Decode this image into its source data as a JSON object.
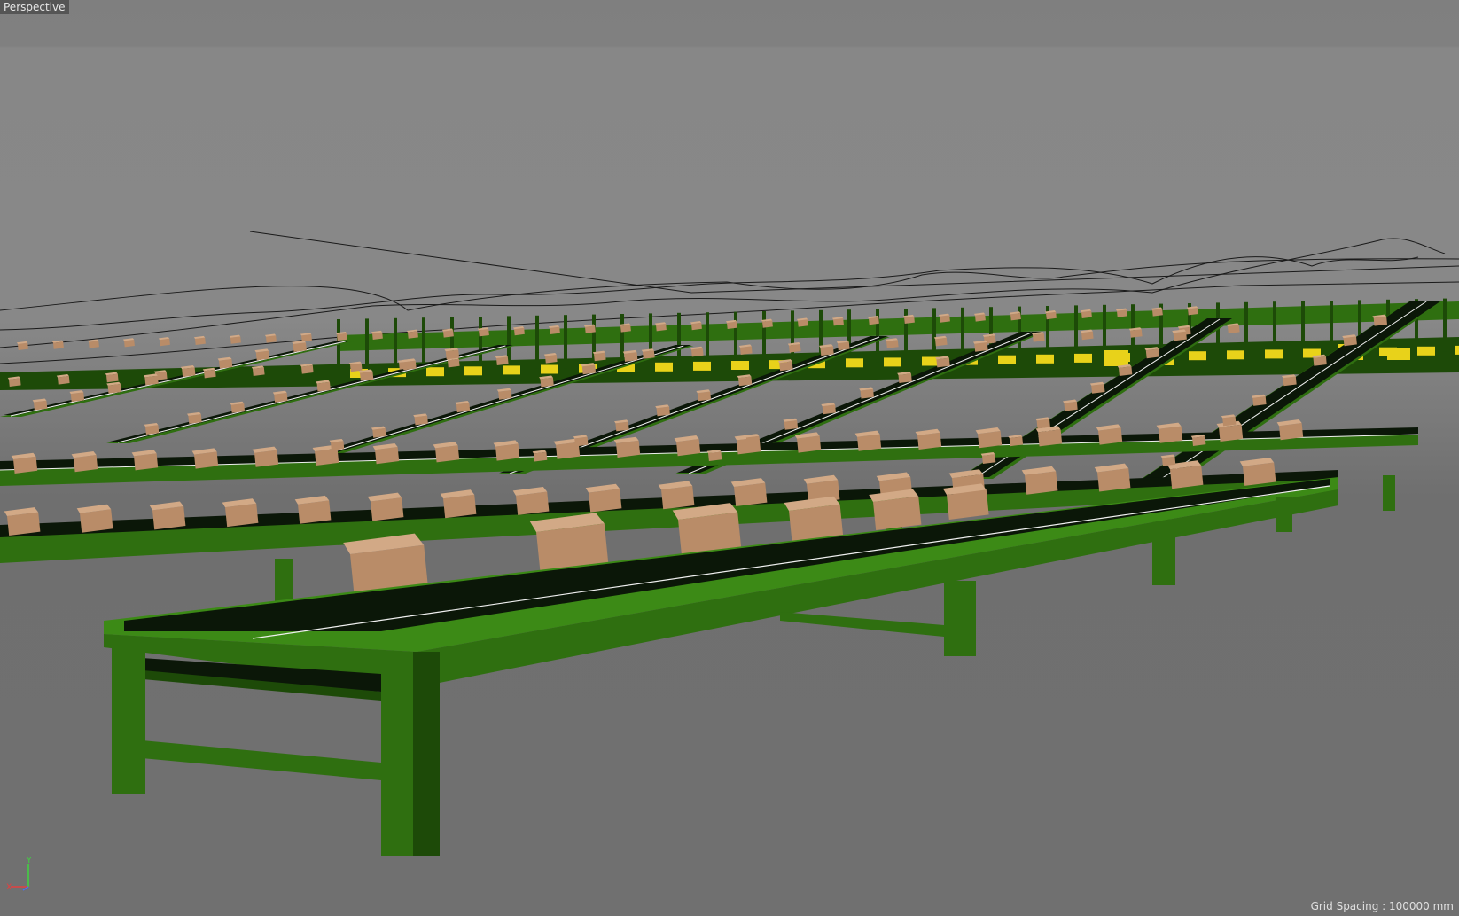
{
  "viewport": {
    "view_label": "Perspective",
    "grid_spacing": "Grid Spacing : 100000 mm",
    "axis_labels": {
      "y": "Y",
      "x": "X"
    }
  },
  "scene": {
    "colors": {
      "frame": "#2f6f10",
      "frame_dark": "#1d4a08",
      "frame_light": "#3c8a16",
      "belt": "#0b1708",
      "box": "#b98c68",
      "box_dark": "#8a6244",
      "box_top": "#d2a986",
      "sorter_item": "#e8d21a",
      "path_line": "#1a1a1a",
      "belt_edge": "#f0f0f0"
    }
  }
}
